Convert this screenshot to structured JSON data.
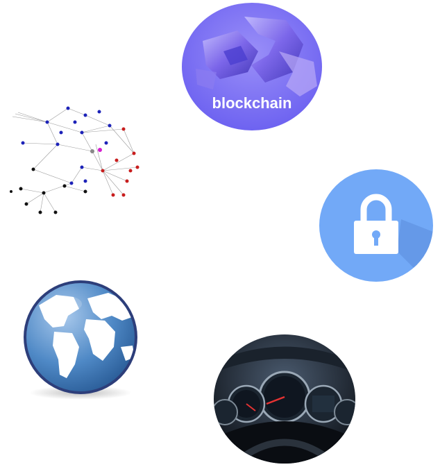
{
  "blockchain_tile": {
    "label": "blockchain",
    "icon": "chain-icon"
  },
  "network_tile": {
    "icon": "network-graph-icon"
  },
  "lock_tile": {
    "icon": "lock-icon"
  },
  "globe_tile": {
    "icon": "globe-icon"
  },
  "dashboard_tile": {
    "icon": "speedometer-icon"
  },
  "colors": {
    "blockchain_bg": "#7f7cf6",
    "lock_bg": "#72a9f7",
    "globe_ocean": "#3d78b8",
    "node_blue": "#1c22b8",
    "node_red": "#c81d1d",
    "node_black": "#111111",
    "node_magenta": "#d41ccf"
  }
}
